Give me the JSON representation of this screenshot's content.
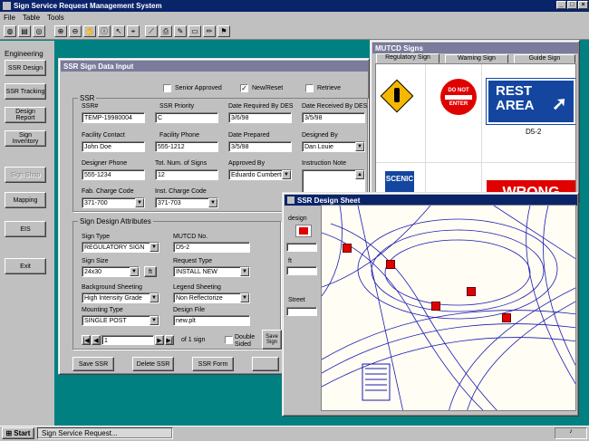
{
  "app": {
    "title": "Sign Service Request Management System",
    "menu": [
      "File",
      "Table",
      "Tools"
    ]
  },
  "toolbar_icons": [
    "globe-icon",
    "layers-icon",
    "world-icon",
    "zoom-in-icon",
    "zoom-out-icon",
    "pan-hand-icon",
    "info-icon",
    "select-arrow-icon",
    "identify-icon",
    "polyline-icon",
    "print-icon",
    "draw-icon",
    "eraser-icon",
    "pencil-icon",
    "sign-icon"
  ],
  "sidebar": {
    "heading": "Engineering",
    "items": [
      "SSR Design",
      "SSR Tracking",
      "Design Report",
      "Sign Inventory",
      "Sign Shop",
      "Mapping",
      "EIS",
      "Exit"
    ]
  },
  "ssr_window": {
    "title": "SSR Sign Data Input",
    "checks": {
      "senior": "Senior Approved",
      "new_reset": "New/Reset",
      "retrieve": "Retrieve"
    },
    "ssr_heading": "SSR",
    "labels": {
      "ssr_no": "SSR#",
      "priority": "SSR Priority",
      "date_req": "Date Required By DES",
      "date_recv": "Date Received By DES",
      "contact": "Facility Contact",
      "phone": "Facility Phone",
      "date_prep": "Date Prepared",
      "designed_by": "Designed By",
      "designer_phone": "Designer Phone",
      "tot_num": "Tot. Num. of Signs",
      "approved_by": "Approved By",
      "instruction": "Instruction Note",
      "fab_code": "Fab. Charge Code",
      "inst_code": "Inst. Charge Code"
    },
    "values": {
      "ssr_no": "TEMP-19980004",
      "priority": "C",
      "date_req": "3/6/98",
      "date_recv": "3/5/98",
      "contact": "John Doe",
      "phone": "555-1212",
      "date_prep": "3/5/98",
      "designed_by": "Dan Louie",
      "designer_phone": "555-1234",
      "tot_num": "12",
      "approved_by": "Eduardo Cumberti",
      "fab_code": "371-700",
      "inst_code": "371-703"
    },
    "design_heading": "Sign Design Attributes",
    "dlabels": {
      "sign_type": "Sign Type",
      "mutcd": "MUTCD No.",
      "sign_size": "Sign Size",
      "request_type": "Request Type",
      "bg_sheeting": "Background Sheeting",
      "legend_sheeting": "Legend Sheeting",
      "mounting": "Mounting Type",
      "design_file": "Design File",
      "double_sided": "Double Sided"
    },
    "dvalues": {
      "sign_type": "REGULATORY SIGN",
      "mutcd": "D5-2",
      "sign_size": "24x30",
      "unit": "ft",
      "request_type": "INSTALL NEW",
      "bg_sheeting": "High Intensity Grade",
      "legend_sheeting": "Non Reflectorize",
      "mounting": "SINGLE POST",
      "design_file": "new.plt"
    },
    "nav": {
      "record": "1",
      "of": "of 1 sign"
    },
    "buttons": {
      "save_ssr": "Save SSR",
      "delete_ssr": "Delete SSR",
      "ssr_form": "SSR Form",
      "save_sign": "Save Sign"
    }
  },
  "mutcd": {
    "title": "MUTCD Signs",
    "tabs": [
      "Regulatory Sign",
      "Warning Sign",
      "Guide Sign"
    ],
    "signs": {
      "do_not": "DO NOT",
      "enter": "ENTER",
      "rest_area_1": "REST",
      "rest_area_2": "AREA",
      "rest_code": "D5-2",
      "scenic": "SCENIC",
      "wrong": "WRONG"
    }
  },
  "design_sheet": {
    "title": "SSR Design Sheet",
    "labels": {
      "design": "design",
      "ft": "ft",
      "street": "Street"
    }
  },
  "taskbar": {
    "start": "Start",
    "task": "Sign Service Request..."
  },
  "colors": {
    "titlebar": "#0a246a",
    "desktop": "#008080",
    "window": "#c0c0c0",
    "sign_red": "#e00000",
    "sign_blue": "#1446a0",
    "sheet_blue": "#1a1ab4"
  }
}
